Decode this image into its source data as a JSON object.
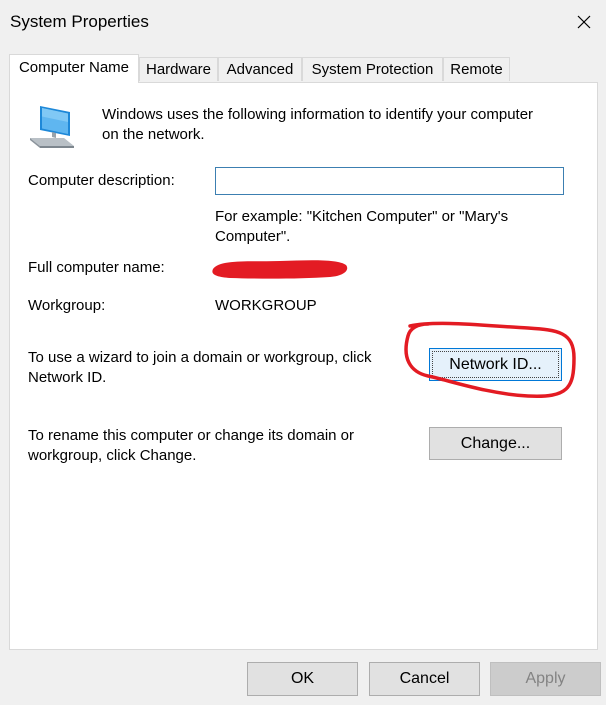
{
  "window": {
    "title": "System Properties",
    "close_icon": "close-icon"
  },
  "tabs": [
    {
      "label": "Computer Name",
      "active": true
    },
    {
      "label": "Hardware",
      "active": false
    },
    {
      "label": "Advanced",
      "active": false
    },
    {
      "label": "System Protection",
      "active": false
    },
    {
      "label": "Remote",
      "active": false
    }
  ],
  "computer_name_tab": {
    "icon": "computer-icon",
    "intro_line1": "Windows uses the following information to identify your computer",
    "intro_line2": "on the network.",
    "description_label": "Computer description:",
    "description_value": "",
    "example_line1": "For example: \"Kitchen Computer\" or \"Mary's",
    "example_line2": "Computer\".",
    "full_name_label": "Full computer name:",
    "full_name_value_redacted": true,
    "workgroup_label": "Workgroup:",
    "workgroup_value": "WORKGROUP",
    "wizard_text_line1": "To use a wizard to join a domain or workgroup, click",
    "wizard_text_line2": "Network ID.",
    "network_id_button": "Network ID...",
    "rename_text_line1": "To rename this computer or change its domain or",
    "rename_text_line2": "workgroup, click Change.",
    "change_button": "Change..."
  },
  "footer": {
    "ok_button": "OK",
    "cancel_button": "Cancel",
    "apply_button": "Apply",
    "apply_disabled": true
  },
  "colors": {
    "annotation": "#e31b23",
    "redaction": "#e31b23",
    "focus_border": "#0078d7"
  }
}
